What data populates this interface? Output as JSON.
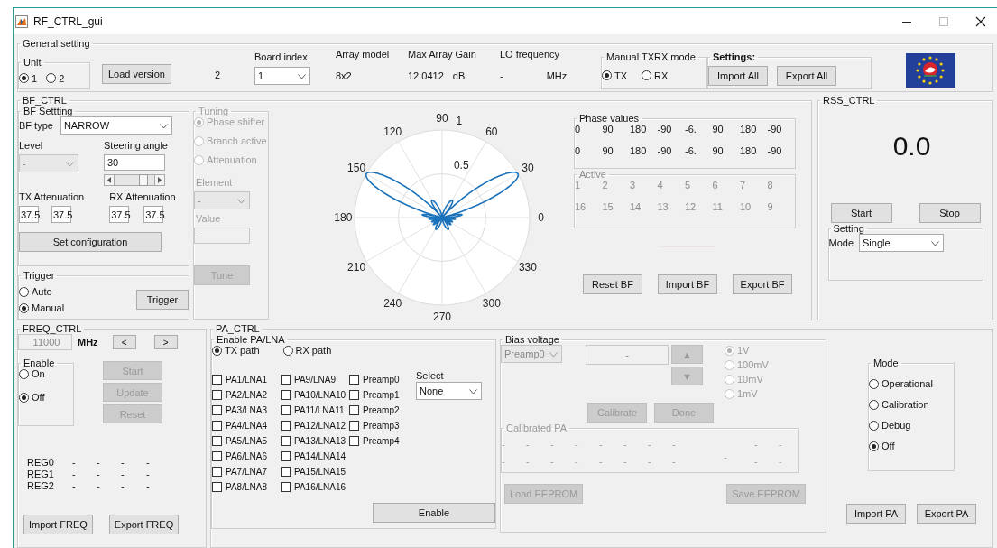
{
  "window": {
    "title": "RF_CTRL_gui"
  },
  "general": {
    "title": "General setting",
    "unit": {
      "title": "Unit",
      "options": [
        {
          "label": "1",
          "selected": true
        },
        {
          "label": "2",
          "selected": false
        }
      ]
    },
    "load_button": "Load version",
    "version": "2",
    "board_index": {
      "label": "Board index",
      "value": "1"
    },
    "array_model": {
      "label": "Array model",
      "value": "8x2"
    },
    "max_gain": {
      "label": "Max Array Gain",
      "value": "12.0412",
      "unit": "dB"
    },
    "lo": {
      "label": "LO frequency",
      "value": "-",
      "unit": "MHz"
    },
    "txrx": {
      "title": "Manual TXRX mode",
      "options": [
        {
          "label": "TX",
          "selected": true
        },
        {
          "label": "RX",
          "selected": false
        }
      ]
    },
    "settings": {
      "title": "Settings:",
      "buttons": [
        "Import All",
        "Export All"
      ]
    }
  },
  "bf_ctrl": {
    "title": "BF_CTRL",
    "bf_setting": {
      "title": "BF Settting",
      "bf_type": {
        "label": "BF type",
        "value": "NARROW"
      },
      "level": {
        "label": "Level",
        "value": "-",
        "disabled": true
      },
      "steering": {
        "label": "Steering angle",
        "value": "30",
        "level": 0.72
      },
      "tx_att": {
        "label": "TX Attenuation",
        "values": [
          "37.5",
          "37.5"
        ]
      },
      "rx_att": {
        "label": "RX Attenuation",
        "values": [
          "37.5",
          "37.5"
        ]
      },
      "set_button": "Set configuration"
    },
    "trigger": {
      "title": "Trigger",
      "options": [
        {
          "label": "Auto",
          "selected": false
        },
        {
          "label": "Manual",
          "selected": true
        }
      ],
      "button": "Trigger"
    },
    "tuning": {
      "title": "Tuning",
      "disabled": true,
      "options": [
        {
          "label": "Phase shifter",
          "selected": true
        },
        {
          "label": "Branch active",
          "selected": false
        },
        {
          "label": "Attenuation",
          "selected": false
        }
      ],
      "element": {
        "label": "Element",
        "value": "-"
      },
      "value": {
        "label": "Value",
        "value": "-"
      },
      "button": "Tune"
    },
    "polar": {
      "angle_labels": [
        "0",
        "30",
        "60",
        "90",
        "120",
        "150",
        "180",
        "210",
        "240",
        "270",
        "300",
        "330"
      ],
      "radius_labels": [
        "1",
        "0.5"
      ]
    },
    "phase_values": {
      "title": "Phase values",
      "rows": [
        [
          "0",
          "90",
          "180",
          "-90",
          "-6.",
          "90",
          "180",
          "-90"
        ],
        [
          "0",
          "90",
          "180",
          "-90",
          "-6.",
          "90",
          "180",
          "-90"
        ]
      ]
    },
    "active": {
      "title": "Active",
      "disabled": true,
      "rows": [
        [
          "1",
          "2",
          "3",
          "4",
          "5",
          "6",
          "7",
          "8"
        ],
        [
          "16",
          "15",
          "14",
          "13",
          "12",
          "11",
          "10",
          "9"
        ]
      ]
    },
    "buttons": [
      "Reset BF",
      "Import BF",
      "Export BF"
    ]
  },
  "rss_ctrl": {
    "title": "RSS_CTRL",
    "reading": "0.0",
    "buttons": [
      "Start",
      "Stop"
    ],
    "setting": {
      "title": "Setting",
      "mode_label": "Mode",
      "mode": "Single"
    }
  },
  "freq_ctrl": {
    "title": "FREQ_CTRL",
    "frequency": "11000",
    "unit": "MHz",
    "prev": "<",
    "next": ">",
    "enable": {
      "title": "Enable",
      "options": [
        {
          "label": "On",
          "selected": false
        },
        {
          "label": "Off",
          "selected": true
        }
      ]
    },
    "buttons": [
      {
        "label": "Start",
        "disabled": true
      },
      {
        "label": "Update",
        "disabled": true
      },
      {
        "label": "Reset",
        "disabled": true
      }
    ],
    "registers": [
      {
        "name": "REG0",
        "values": [
          "-",
          "-",
          "-",
          "-"
        ]
      },
      {
        "name": "REG1",
        "values": [
          "-",
          "-",
          "-",
          "-"
        ]
      },
      {
        "name": "REG2",
        "values": [
          "-",
          "-",
          "-",
          "-"
        ]
      }
    ],
    "footer_buttons": [
      "Import FREQ",
      "Export FREQ"
    ]
  },
  "pa_ctrl": {
    "title": "PA_CTRL",
    "enable": {
      "title": "Enable PA/LNA",
      "paths": [
        {
          "label": "TX path",
          "selected": true
        },
        {
          "label": "RX path",
          "selected": false
        }
      ],
      "columns": [
        [
          {
            "label": "PA1/LNA1",
            "checked": false
          },
          {
            "label": "PA2/LNA2",
            "checked": false
          },
          {
            "label": "PA3/LNA3",
            "checked": false
          },
          {
            "label": "PA4/LNA4",
            "checked": false
          },
          {
            "label": "PA5/LNA5",
            "checked": false
          },
          {
            "label": "PA6/LNA6",
            "checked": false
          },
          {
            "label": "PA7/LNA7",
            "checked": false
          },
          {
            "label": "PA8/LNA8",
            "checked": false
          }
        ],
        [
          {
            "label": "PA9/LNA9",
            "checked": false
          },
          {
            "label": "PA10/LNA10",
            "checked": false
          },
          {
            "label": "PA11/LNA11",
            "checked": false
          },
          {
            "label": "PA12/LNA12",
            "checked": false
          },
          {
            "label": "PA13/LNA13",
            "checked": false
          },
          {
            "label": "PA14/LNA14",
            "checked": false
          },
          {
            "label": "PA15/LNA15",
            "checked": false
          },
          {
            "label": "PA16/LNA16",
            "checked": false
          }
        ],
        [
          {
            "label": "Preamp0",
            "checked": false
          },
          {
            "label": "Preamp1",
            "checked": false
          },
          {
            "label": "Preamp2",
            "checked": false
          },
          {
            "label": "Preamp3",
            "checked": false
          },
          {
            "label": "Preamp4",
            "checked": false
          }
        ]
      ],
      "select": {
        "label": "Select",
        "value": "None"
      },
      "button": "Enable"
    },
    "bias": {
      "title": "Bias voltage",
      "disabled": true,
      "preamp": "Preamp0",
      "value": "-",
      "up": "▲",
      "down": "▼",
      "steps": [
        {
          "label": "1V",
          "selected": true
        },
        {
          "label": "100mV",
          "selected": false
        },
        {
          "label": "10mV",
          "selected": false
        },
        {
          "label": "1mV",
          "selected": false
        }
      ],
      "buttons": [
        "Calibrate",
        "Done"
      ],
      "calibrated": {
        "title": "Calibrated PA",
        "rows": [
          [
            "-",
            "-",
            "-",
            "-",
            "-",
            "-",
            "-",
            "-",
            "-",
            "-"
          ],
          [
            "-",
            "-",
            "-",
            "-",
            "-",
            "-",
            "-",
            "-",
            "-",
            "-"
          ]
        ],
        "middle": "-"
      },
      "load": "Load EEPROM",
      "save": "Save EEPROM"
    },
    "mode": {
      "title": "Mode",
      "options": [
        {
          "label": "Operational",
          "selected": false
        },
        {
          "label": "Calibration",
          "selected": false
        },
        {
          "label": "Debug",
          "selected": false
        },
        {
          "label": "Off",
          "selected": true
        }
      ]
    },
    "buttons": [
      "Import PA",
      "Export PA"
    ]
  }
}
